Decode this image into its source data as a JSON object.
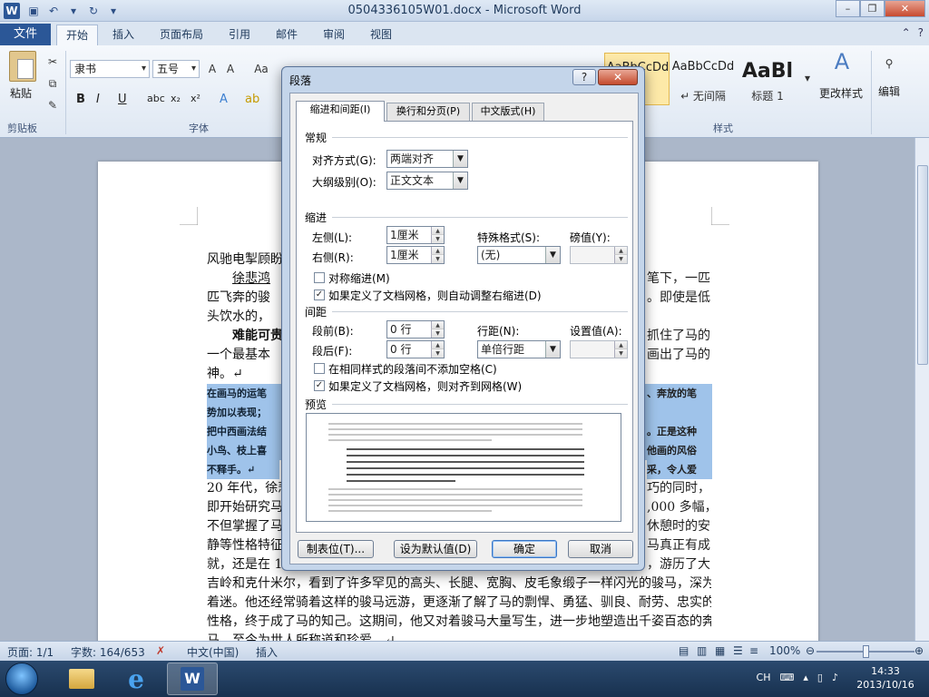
{
  "window": {
    "title": "0504336105W01.docx - Microsoft Word",
    "app_icon": "W"
  },
  "ribbon_tabs": {
    "file": "文件",
    "home": "开始",
    "insert": "插入",
    "layout": "页面布局",
    "references": "引用",
    "mailings": "邮件",
    "review": "审阅",
    "view": "视图"
  },
  "ribbon": {
    "paste": "粘贴",
    "clipboard": "剪贴板",
    "font_name": "隶书",
    "font_size": "五号",
    "font_group": "字体",
    "style_group": "样式",
    "styles": [
      "AaBbCcDd",
      "AaBbCcDd",
      "AaBl"
    ],
    "style_names": [
      "",
      "↵ 无间隔",
      "标题 1"
    ],
    "change_styles": "更改样式",
    "edit": "编辑"
  },
  "document": {
    "lines": [
      "风驰电掣顾盼",
      "徐悲鸿",
      "匹飞奔的骏",
      "头饮水的，",
      "难能可贵",
      "一个最基本",
      "神。↵",
      "20 年代，徐悲",
      "即开始研究马",
      "不但掌握了马",
      "静等性格特征",
      "就，还是在 1",
      "吉岭和克什米尔，看到了许多罕见的高头、长腿、宽胸、皮毛象缎子一样闪光的骏马，深为",
      "着迷。他还经常骑着这样的骏马远游，更逐渐了解了马的剽悍、勇猛、驯良、耐劳、忠实的",
      "性格，终于成了马的知己。这期间，他又对着骏马大量写生，进一步地塑造出千姿百态的奔",
      "马，至今为世人所称道和珍爱。↵"
    ],
    "right_fragments": [
      "笔下，一匹",
      "。即使是低",
      "抓住了马的",
      "画出了马的",
      "巧的同时，",
      ",000 多幅，",
      "休憩时的安",
      "马真正有成",
      "，游历了大"
    ],
    "highlight_lines": [
      "在画马的运笔",
      "势加以表现；",
      "把中西画法结",
      "小鸟、枝上喜",
      "不释手。↵"
    ],
    "highlight_right": [
      "、奔放的笔",
      "。正是这种",
      "他画的风俗",
      "采，令人爱"
    ]
  },
  "statusbar": {
    "page": "页面: 1/1",
    "words": "字数: 164/653",
    "language": "中文(中国)",
    "insert_mode": "插入",
    "zoom": "100%"
  },
  "taskbar": {
    "lang": "CH",
    "time": "14:33",
    "date": "2013/10/16"
  },
  "dialog": {
    "title": "段落",
    "help": "?",
    "tabs": [
      "缩进和间距(I)",
      "换行和分页(P)",
      "中文版式(H)"
    ],
    "general": "常规",
    "alignment_label": "对齐方式(G):",
    "alignment_value": "两端对齐",
    "outline_label": "大纲级别(O):",
    "outline_value": "正文文本",
    "indent": "缩进",
    "left_label": "左侧(L):",
    "left_value": "1厘米",
    "right_label": "右侧(R):",
    "right_value": "1厘米",
    "special_label": "特殊格式(S):",
    "special_value": "(无)",
    "by_label": "磅值(Y):",
    "mirror_indent": "对称缩进(M)",
    "auto_right_indent": "如果定义了文档网格，则自动调整右缩进(D)",
    "spacing": "间距",
    "before_label": "段前(B):",
    "before_value": "0 行",
    "after_label": "段后(F):",
    "after_value": "0 行",
    "line_spacing_label": "行距(N):",
    "line_spacing_value": "单倍行距",
    "at_label": "设置值(A):",
    "no_space_same_style": "在相同样式的段落间不添加空格(C)",
    "snap_to_grid": "如果定义了文档网格，则对齐到网格(W)",
    "preview": "预览",
    "buttons": {
      "tabs": "制表位(T)...",
      "set_default": "设为默认值(D)",
      "ok": "确定",
      "cancel": "取消"
    },
    "checks": {
      "mirror_indent": false,
      "auto_right_indent": true,
      "no_space_same_style": false,
      "snap_to_grid": true
    }
  }
}
